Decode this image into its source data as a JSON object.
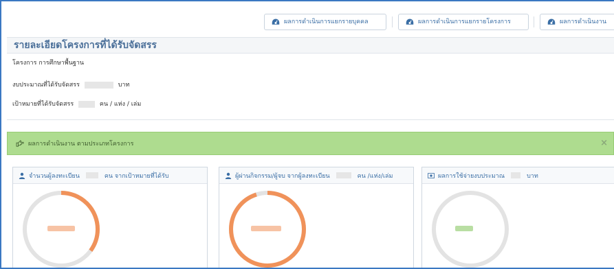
{
  "top_buttons": [
    {
      "label": "ผลการดำเนินการแยกรายบุคคล",
      "icon": "dashboard-icon"
    },
    {
      "label": "ผลการดำเนินการแยกรายโครงการ",
      "icon": "dashboard-icon"
    },
    {
      "label": "ผลการดำเนินงาน",
      "icon": "dashboard-icon"
    }
  ],
  "page": {
    "title": "รายละเอียดโครงการที่ได้รับจัดสรร",
    "project_line": "โครงการ การศึกษาพื้นฐาน",
    "budget_label": "งบประมาณที่ได้รับจัดสรร",
    "budget_unit": "บาท",
    "target_label": "เป้าหมายที่ได้รับจัดสรร",
    "target_unit": "คน / แห่ง / เล่ม"
  },
  "alert": {
    "text": "ผลการดำเนินงาน ตามประเภทโครงการ",
    "icon": "hand-point-right-icon",
    "close": "×"
  },
  "cards": [
    {
      "icon": "user-icon",
      "title_prefix": "จำนวนผู้ลงทะเบียน",
      "title_suffix": "คน จากเป้าหมายที่ได้รับ",
      "progress": 0.35,
      "color": "#f0925a"
    },
    {
      "icon": "user-icon",
      "title_prefix": "ผู้ผ่านกิจกรรม/ผู้จบ จากผู้ลงทะเบียน",
      "title_suffix": "คน /แห่ง/เล่ม",
      "progress": 0.95,
      "color": "#f0925a"
    },
    {
      "icon": "money-icon",
      "title_prefix": "ผลการใช้จ่ายงบประมาณ",
      "title_suffix": "บาท",
      "progress": 0.0,
      "color": "#8fc96f"
    }
  ],
  "colors": {
    "frame": "#3a78c2",
    "alert_bg": "#aedc8f",
    "donut_track": "#e3e3e3",
    "link": "#3a6ea5"
  }
}
